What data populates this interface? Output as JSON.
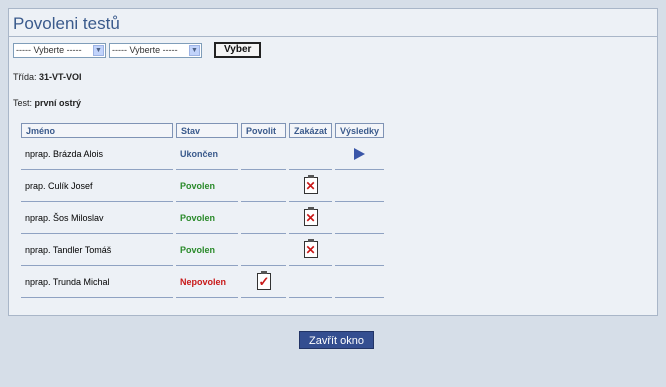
{
  "page_title": "Povoleni testů",
  "filters": {
    "select1_value": "----- Vyberte -----",
    "select2_value": "----- Vyberte -----",
    "button_label": "Vyber"
  },
  "class_info": {
    "label": "Třída:",
    "value": "31-VT-VOI"
  },
  "test_info": {
    "label": "Test:",
    "value": "první ostrý"
  },
  "table": {
    "headers": [
      "Jméno",
      "Stav",
      "Povolit",
      "Zakázat",
      "Výsledky"
    ],
    "rows": [
      {
        "name": "nprap. Brázda Alois",
        "status": "Ukončen",
        "status_type": "ukoncen",
        "povolit_icon": "",
        "zakazat_icon": "",
        "vysledky_icon": "play-icon"
      },
      {
        "name": "prap. Culík Josef",
        "status": "Povolen",
        "status_type": "povolen",
        "povolit_icon": "",
        "zakazat_icon": "forbid-clipboard-icon",
        "vysledky_icon": ""
      },
      {
        "name": "nprap. Šos Miloslav",
        "status": "Povolen",
        "status_type": "povolen",
        "povolit_icon": "",
        "zakazat_icon": "forbid-clipboard-icon",
        "vysledky_icon": ""
      },
      {
        "name": "nprap. Tandler Tomáš",
        "status": "Povolen",
        "status_type": "povolen",
        "povolit_icon": "",
        "zakazat_icon": "forbid-clipboard-icon",
        "vysledky_icon": ""
      },
      {
        "name": "nprap. Trunda Michal",
        "status": "Nepovolen",
        "status_type": "nepovolen",
        "povolit_icon": "allow-clipboard-icon",
        "zakazat_icon": "",
        "vysledky_icon": ""
      }
    ]
  },
  "close_button_label": "Zavřít okno",
  "colors": {
    "title": "#3a5a8c",
    "ukoncen": "#3a5a8c",
    "povolen": "#2a8a2a",
    "nepovolen": "#c81818",
    "close_button": "#344e90"
  }
}
